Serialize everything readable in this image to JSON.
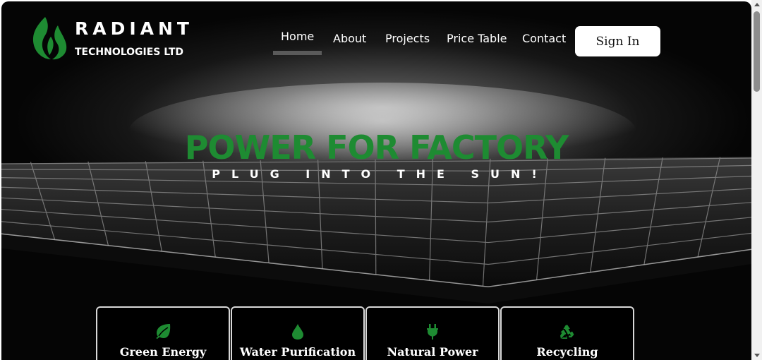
{
  "brand": {
    "name": "RADIANT",
    "tagline": "TECHNOLOGIES LTD",
    "logo_icon": "leaf-flame-logo-icon",
    "logo_color": "#1e8b32"
  },
  "nav": {
    "items": [
      {
        "label": "Home",
        "active": true
      },
      {
        "label": "About",
        "active": false
      },
      {
        "label": "Projects",
        "active": false
      },
      {
        "label": "Price Table",
        "active": false
      },
      {
        "label": "Contact",
        "active": false
      }
    ],
    "signin_label": "Sign In"
  },
  "hero": {
    "title": "POWER FOR FACTORY",
    "subtitle": "PLUG INTO THE SUN!",
    "title_color": "#1e8b32"
  },
  "features": [
    {
      "label": "Green Energy",
      "icon": "leaf-icon"
    },
    {
      "label": "Water Purification",
      "icon": "water-drop-icon"
    },
    {
      "label": "Natural Power",
      "icon": "plug-icon"
    },
    {
      "label": "Recycling",
      "icon": "recycle-icon"
    }
  ],
  "colors": {
    "accent": "#1e8b32",
    "background": "#050505"
  }
}
